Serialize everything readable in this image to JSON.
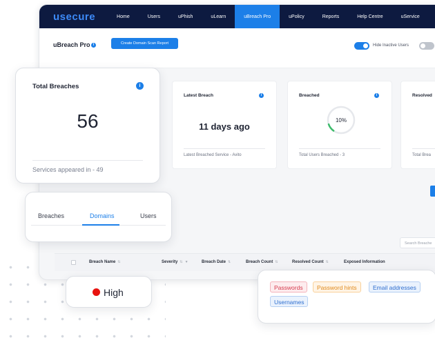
{
  "app": {
    "logo": "usecure",
    "nav": [
      "Home",
      "Users",
      "uPhish",
      "uLearn",
      "uBreach Pro",
      "uPolicy",
      "Reports",
      "Help Centre",
      "uService"
    ],
    "active_nav": "uBreach Pro"
  },
  "header": {
    "title": "uBreach Pro",
    "create_button": "Create Domain Scan Report",
    "hide_inactive_label": "Hide Inactive Users"
  },
  "cards": {
    "latest_breach": {
      "title": "Latest Breach",
      "value": "11 days ago",
      "footer": "Latest Breached Service - Avito"
    },
    "breached": {
      "title": "Breached",
      "percent_label": "10%",
      "percent": 10,
      "footer": "Total Users Breached - 3"
    },
    "resolved": {
      "title": "Resolved",
      "footer": "Total Brea"
    }
  },
  "search": {
    "placeholder": "Search Breache"
  },
  "table": {
    "headers": [
      "Breach Name",
      "Severity",
      "Breach Date",
      "Breach Count",
      "Resolved Count",
      "Exposed Information"
    ]
  },
  "total_breaches": {
    "title": "Total Breaches",
    "value": "56",
    "footer": "Services appeared in - 49"
  },
  "tabs": [
    "Breaches",
    "Domains",
    "Users"
  ],
  "active_tab": "Domains",
  "severity": {
    "label": "High",
    "color": "#e8130f"
  },
  "exposed_info": [
    "Passwords",
    "Password hints",
    "Email addresses",
    "Usernames"
  ],
  "colors": {
    "accent": "#1c7fe8",
    "nav_bg": "#0d1a40",
    "success_ring": "#3dbb6b"
  },
  "icons": [
    "info-icon",
    "sort-icon",
    "filter-icon"
  ]
}
